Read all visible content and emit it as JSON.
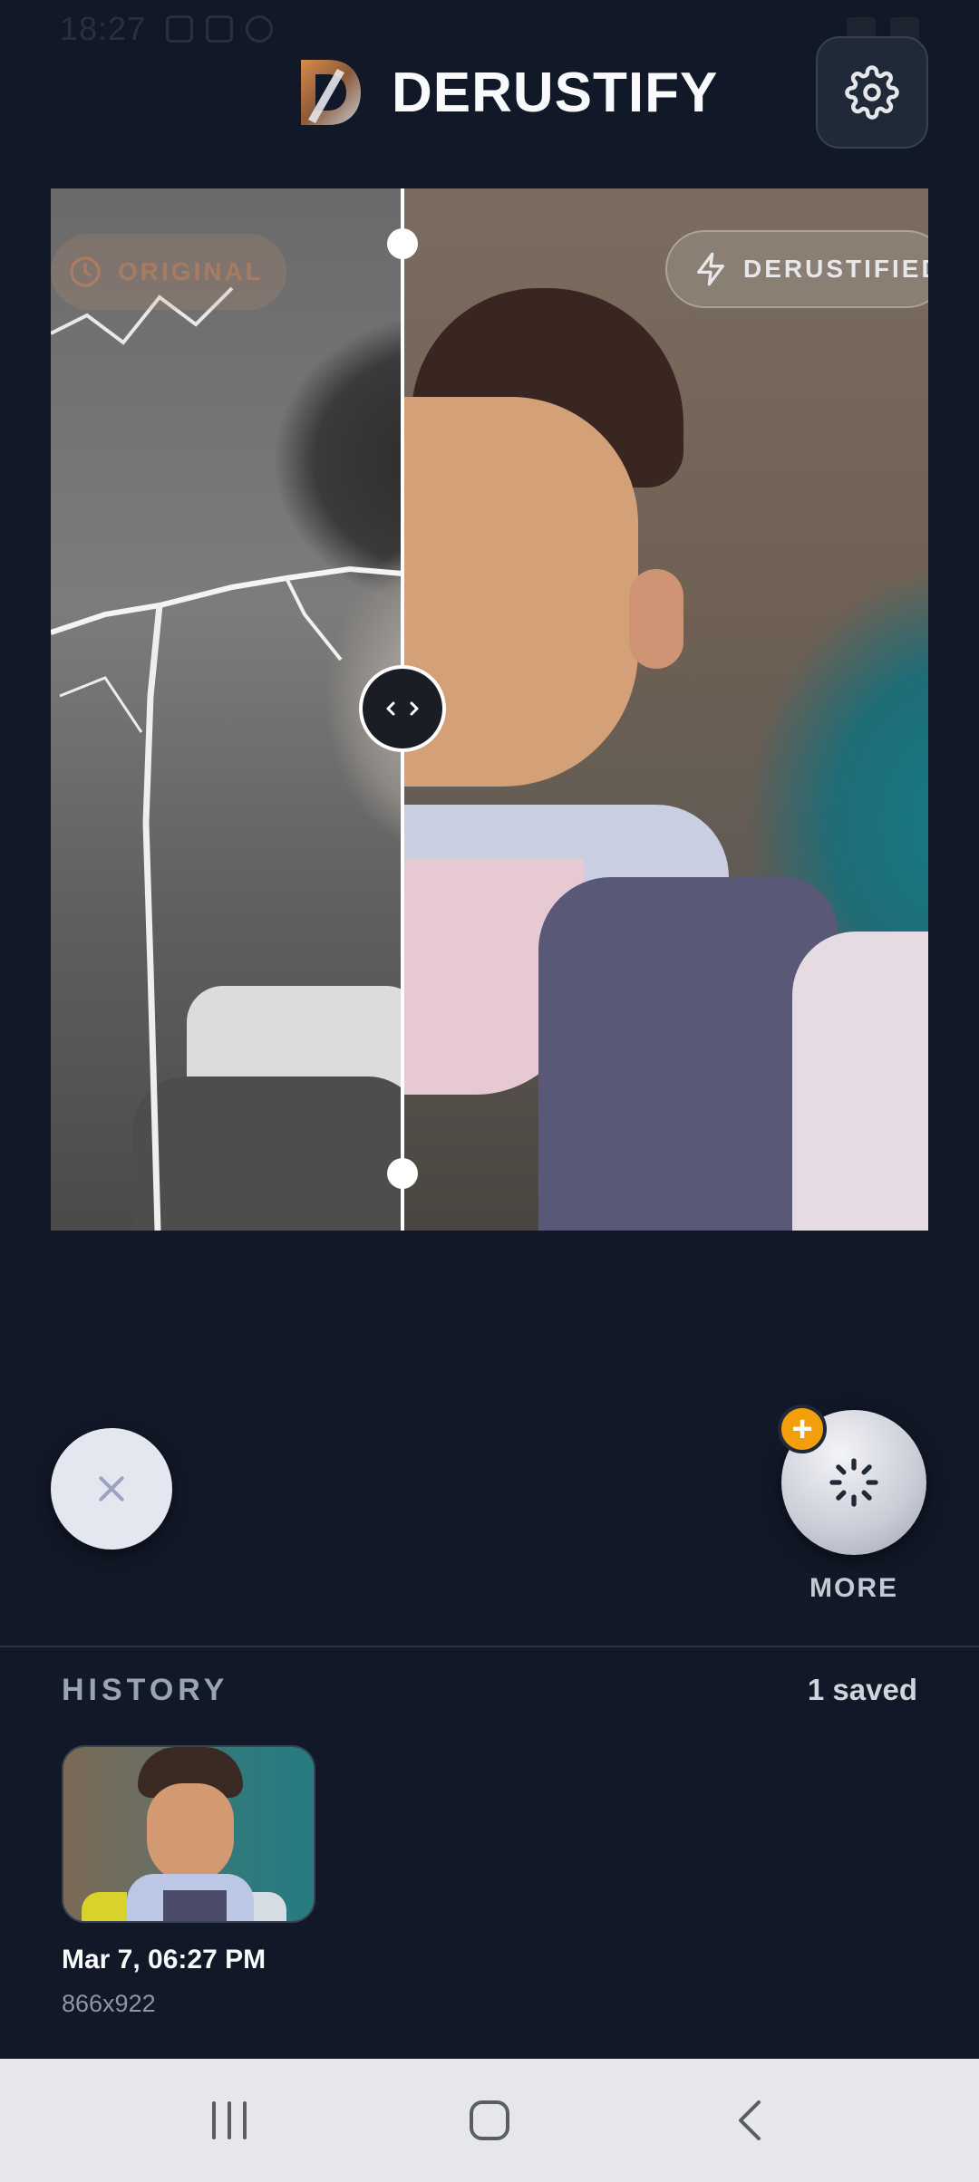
{
  "status_bar": {
    "time": "18:27"
  },
  "header": {
    "app_title": "DERUSTIFY",
    "settings_icon": "gear-icon"
  },
  "compare": {
    "label_original": "ORIGINAL",
    "label_derustified": "DERUSTIFIED",
    "icons": {
      "original": "clock-icon",
      "derustified": "lightning-icon",
      "handle": "chevron-left-right-icon"
    }
  },
  "actions": {
    "close_icon": "close-icon",
    "more_icon": "loading-spinner-icon",
    "more_badge": "+",
    "more_label": "MORE"
  },
  "history": {
    "title": "HISTORY",
    "count": "1 saved",
    "items": [
      {
        "date": "Mar 7, 06:27 PM",
        "size": "866x922"
      }
    ]
  },
  "colors": {
    "background": "#111827",
    "accent_badge": "#f59e0b",
    "nav_bar": "#e6e7ea"
  }
}
